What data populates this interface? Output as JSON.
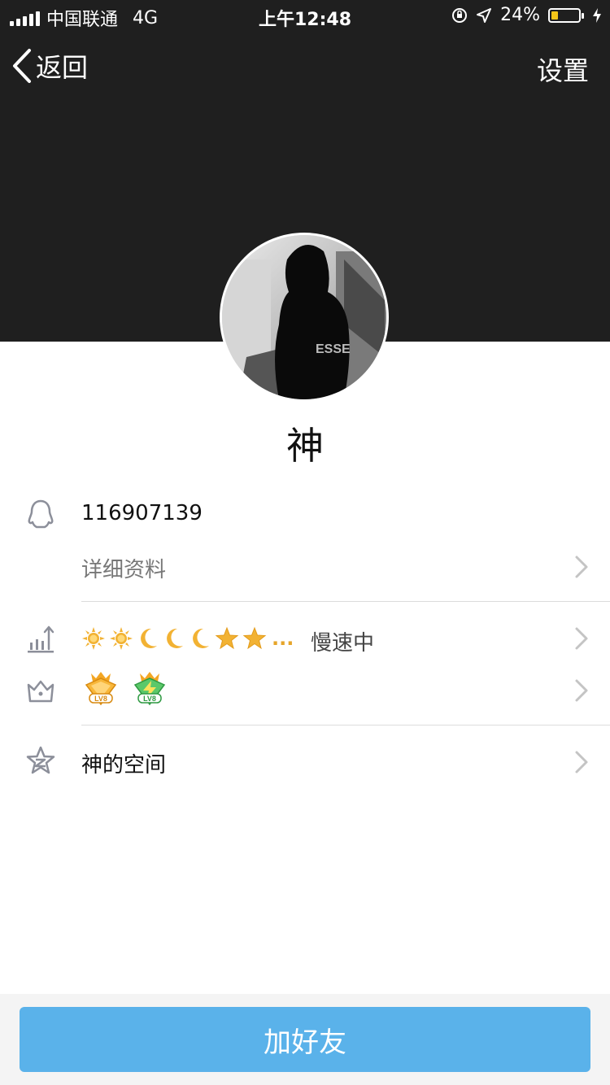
{
  "status_bar": {
    "carrier": "中国联通",
    "network": "4G",
    "time": "上午12:48",
    "battery": "24%",
    "battery_level": 0.24
  },
  "nav": {
    "back_label": "返回",
    "settings_label": "设置"
  },
  "profile": {
    "nickname": "神",
    "qq_number": "116907139",
    "details_label": "详细资料",
    "level_status": "慢速中",
    "level_more": "...",
    "space_label": "神的空间"
  },
  "badges": [
    "LV8",
    "LV8"
  ],
  "actions": {
    "add_friend_label": "加好友"
  },
  "colors": {
    "header_bg": "#1f1f1f",
    "accent_button": "#5ab2ea",
    "battery": "#f5c518",
    "sun": "#f2b233",
    "moon": "#f2b233"
  }
}
